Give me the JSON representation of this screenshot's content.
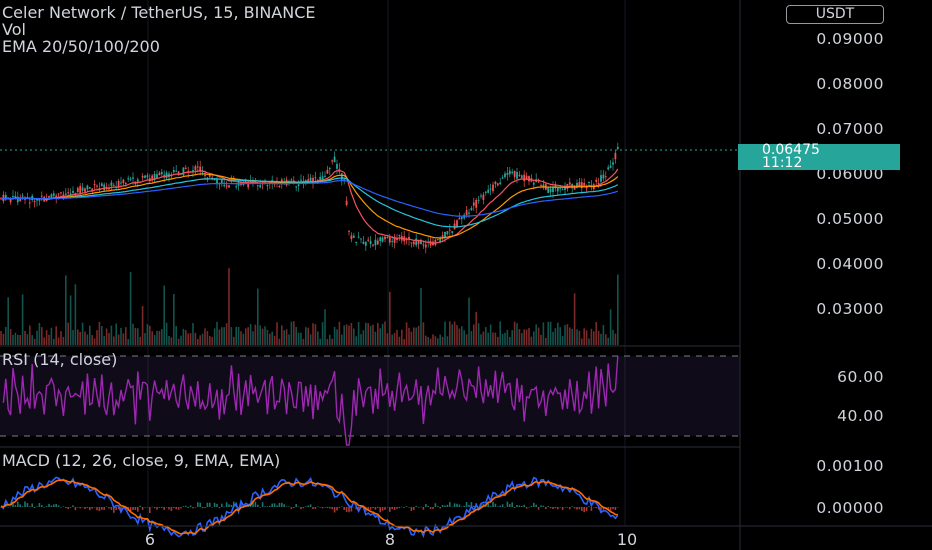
{
  "header": {
    "title": "Celer Network / TetherUS, 15, BINANCE",
    "vol_label": "Vol",
    "ema_label": "EMA 20/50/100/200",
    "currency_button": "USDT"
  },
  "price_axis": [
    "0.09000",
    "0.08000",
    "0.07000",
    "0.06000",
    "0.05000",
    "0.04000",
    "0.03000"
  ],
  "current_price": {
    "price": "0.06475",
    "countdown": "11:12"
  },
  "rsi": {
    "label": "RSI (14, close)",
    "axis": [
      "60.00",
      "40.00"
    ]
  },
  "macd": {
    "label": "MACD (12, 26, close, 9, EMA, EMA)",
    "axis": [
      "0.00100",
      "0.00000"
    ]
  },
  "time_axis": [
    "6",
    "8",
    "10"
  ],
  "colors": {
    "background": "#000000",
    "up": "#26a69a",
    "down": "#ef5350",
    "rsi_line": "#9c27b0",
    "macd_line": "#2962ff",
    "signal_line": "#ff6d00",
    "ema20": "#f7525f",
    "ema50": "#ff9800",
    "ema100": "#26c6da",
    "ema200": "#2962ff"
  }
}
